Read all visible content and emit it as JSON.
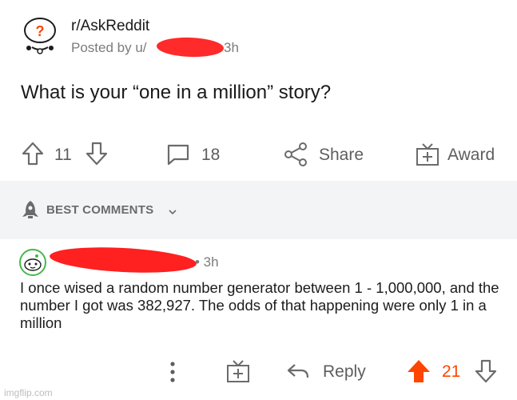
{
  "post": {
    "subreddit": "r/AskReddit",
    "posted_by": "Posted by u/",
    "time": "3h",
    "title": "What is your “one in a million” story?"
  },
  "actions": {
    "upvotes": "11",
    "comments": "18",
    "share_label": "Share",
    "award_label": "Award"
  },
  "sort": {
    "label": "BEST COMMENTS"
  },
  "comment": {
    "meta": "• 3h",
    "text": "I once wised a random number generator between 1 - 1,000,000, and the number I got was 382,927. The odds of that happening were only 1 in a million",
    "reply_label": "Reply",
    "votes": "21"
  },
  "watermark": "imgflip.com",
  "colors": {
    "upvote_active": "#ff4500",
    "redaction": "#ff2a2a",
    "muted": "#7c7c7c"
  }
}
